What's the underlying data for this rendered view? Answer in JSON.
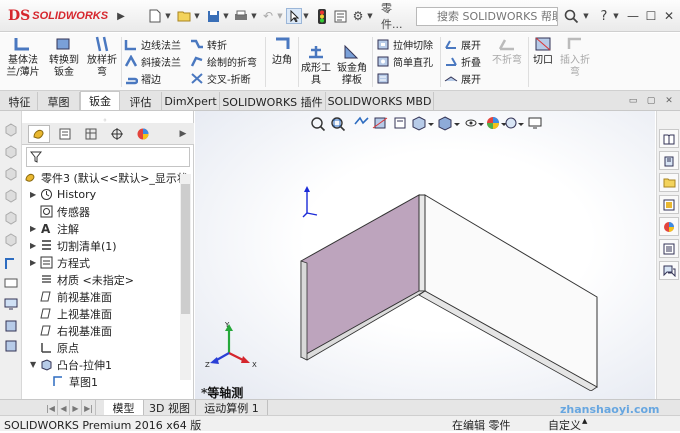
{
  "app": {
    "logo_ds": "DS",
    "logo_text": "SOLIDWORKS"
  },
  "toolbar": {
    "part_label": "零件...",
    "search_placeholder": "搜索 SOLIDWORKS 帮助",
    "help_label": "?"
  },
  "ribbon": {
    "base_flange": "基体法\n兰/薄片",
    "convert_sheet": "转换到\n钣金",
    "lofted_bend": "放样折\n弯",
    "edge_flange": "边线法兰",
    "miter_flange": "斜接法兰",
    "hem": "褶边",
    "sketched_bend": "转折",
    "sketch_bend": "绘制的折弯",
    "cross_break": "交叉-折断",
    "corners": "边角",
    "forming_tool": "成形工\n具",
    "gusset": "钣金角\n撑板",
    "extruded_cut": "拉伸切除",
    "simple_hole": "简单直孔",
    "vent": "",
    "unfold": "展开",
    "fold": "折叠",
    "flatten": "展开",
    "no_bends": "不折弯",
    "rip": "切口",
    "insert_bends": "插入折\n弯"
  },
  "tabs": [
    "特征",
    "草图",
    "钣金",
    "评估",
    "DimXpert",
    "SOLIDWORKS 插件",
    "SOLIDWORKS MBD"
  ],
  "active_tab": 2,
  "tree": {
    "root": "零件3 (默认<<默认>_显示状",
    "items": [
      "History",
      "传感器",
      "注解",
      "切割清单(1)",
      "方程式",
      "材质 <未指定>",
      "前视基准面",
      "上视基准面",
      "右视基准面",
      "原点",
      "凸台-拉伸1",
      "草图1"
    ]
  },
  "viewport": {
    "view_label": "*等轴测"
  },
  "bottom_tabs": [
    "模型",
    "3D 视图",
    "运动算例 1"
  ],
  "status": {
    "left": "SOLIDWORKS Premium 2016 x64 版",
    "editing": "在编辑 零件",
    "custom": "自定义",
    "watermark": "zhanshaoyi.com"
  },
  "colors": {
    "accent_red": "#d6262d",
    "face_purple": "#bda4bd",
    "face_white": "#fafafa"
  }
}
